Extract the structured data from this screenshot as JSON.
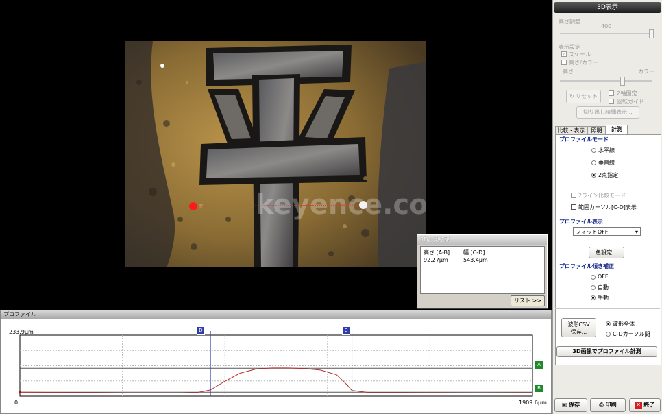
{
  "viewport": {
    "watermark": "keyence.co.jp",
    "result_dialog": {
      "title": "3D計測結果",
      "header_height": "高さ [A-B]",
      "header_width": "幅 [C-D]",
      "value_height": "92.27μm",
      "value_width": "543.4μm",
      "list_button": "リスト >>"
    }
  },
  "profile": {
    "title": "プロファイル",
    "y_max_label": "233.9μm",
    "x_min_label": "0",
    "x_max_label": "1909.6μm",
    "markers": {
      "D": "D",
      "C": "C",
      "A": "A",
      "B": "B"
    },
    "chart_data": {
      "type": "line",
      "x_unit": "μm",
      "y_unit": "μm",
      "xlim": [
        0,
        1909.6
      ],
      "ylim": [
        0,
        233.9
      ],
      "cursor_D_x": 710,
      "cursor_C_x": 1237,
      "cursor_A_y": 107,
      "cursor_B_y": 15,
      "x": [
        0,
        200,
        400,
        600,
        660,
        710,
        760,
        820,
        880,
        940,
        1000,
        1060,
        1120,
        1180,
        1220,
        1237,
        1300,
        1500,
        1700,
        1909.6
      ],
      "y": [
        15,
        14,
        12,
        12,
        14,
        24,
        55,
        88,
        104,
        108,
        108,
        106,
        100,
        82,
        42,
        22,
        14,
        13,
        12,
        13
      ],
      "color": "#b23030"
    }
  },
  "panel": {
    "title": "3D表示",
    "height_adjust": "高さ調整",
    "height_value": "400",
    "display_settings": "表示設定",
    "scale": "スケール",
    "height_color": "高さ/カラー",
    "height": "高さ",
    "color": "カラー",
    "reset": "リセット",
    "z_fix": "Z軸固定",
    "rotate_guide": "回転ガイド",
    "crop_detail": "切り出し精細表示...",
    "tabs": [
      "比較・表示",
      "照明",
      "計測"
    ],
    "profile_mode": "プロファイルモード",
    "mode_options": [
      "水平線",
      "垂直線",
      "2点指定"
    ],
    "two_line_compare": "2ライン比較モード",
    "range_cursor": "範囲カーソル[C-D]表示",
    "profile_display": "プロファイル表示",
    "fit_select": "フィットOFF",
    "color_settings": "色設定...",
    "tilt_correction": "プロファイル傾き補正",
    "tilt_options": [
      "OFF",
      "自動",
      "手動"
    ],
    "csv_save_line1": "波形CSV",
    "csv_save_line2": "保存...",
    "csv_options": [
      "波形全体",
      "C-Dカーソル間"
    ],
    "measure_3d": "3D画像でプロファイル計測",
    "save": "保存",
    "print": "印刷",
    "exit": "終了"
  },
  "colors": {
    "point_A": "#ff1a1a",
    "point_B": "#f2f2f2",
    "cursor_line": "#2f3fa8",
    "marker_green": "#1f8a2a",
    "section_text": "#1a2c8a"
  }
}
